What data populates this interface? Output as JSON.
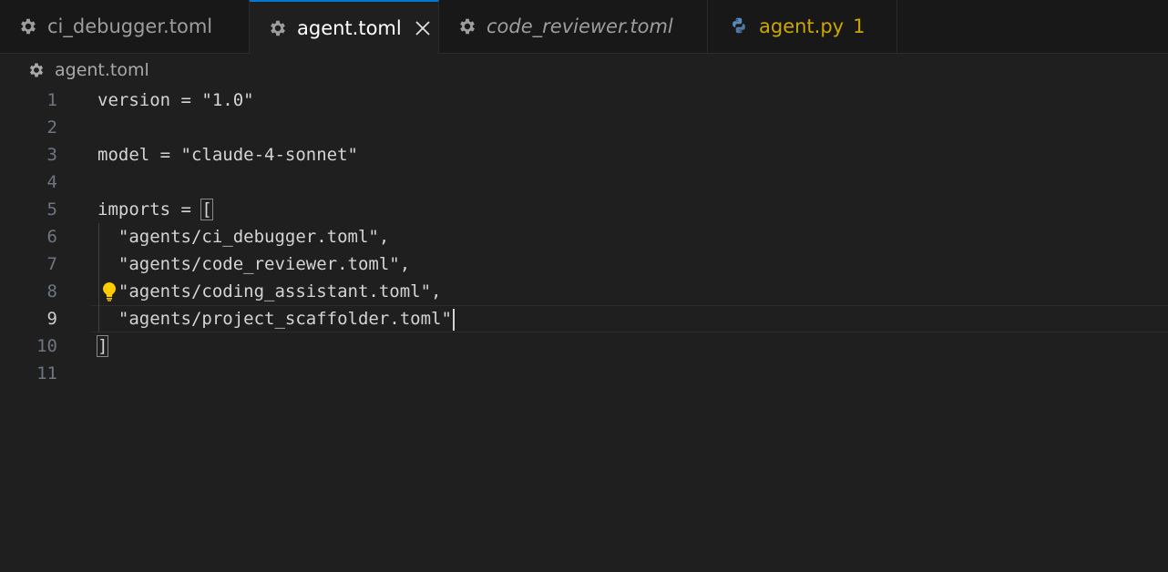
{
  "tabs": [
    {
      "label": "ci_debugger.toml",
      "icon": "gear-icon",
      "active": false
    },
    {
      "label": "agent.toml",
      "icon": "gear-icon",
      "active": true
    },
    {
      "label": "code_reviewer.toml",
      "icon": "gear-icon",
      "active": false
    },
    {
      "label": "agent.py",
      "icon": "python-icon",
      "active": false,
      "badge": "1"
    }
  ],
  "breadcrumb": {
    "label": "agent.toml",
    "icon": "gear-icon"
  },
  "editor": {
    "current_line": 9,
    "lines": [
      {
        "n": "1",
        "text": "version = \"1.0\""
      },
      {
        "n": "2",
        "text": ""
      },
      {
        "n": "3",
        "text": "model = \"claude-4-sonnet\""
      },
      {
        "n": "4",
        "text": ""
      },
      {
        "n": "5",
        "pre": "imports = ",
        "bracket": "["
      },
      {
        "n": "6",
        "text": "  \"agents/ci_debugger.toml\","
      },
      {
        "n": "7",
        "text": "  \"agents/code_reviewer.toml\","
      },
      {
        "n": "8",
        "text": "  \"agents/coding_assistant.toml\","
      },
      {
        "n": "9",
        "text": "  \"agents/project_scaffolder.toml\""
      },
      {
        "n": "10",
        "bracket": "]"
      },
      {
        "n": "11",
        "text": ""
      }
    ]
  },
  "colors": {
    "accent": "#0078d4",
    "warning": "#cca700",
    "background": "#1f1f1f"
  }
}
